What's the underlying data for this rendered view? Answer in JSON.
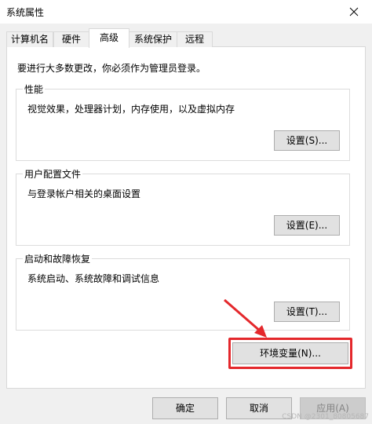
{
  "window": {
    "title": "系统属性"
  },
  "tabs": [
    {
      "label": "计算机名"
    },
    {
      "label": "硬件"
    },
    {
      "label": "高级"
    },
    {
      "label": "系统保护"
    },
    {
      "label": "远程"
    }
  ],
  "admin_notice": "要进行大多数更改，你必须作为管理员登录。",
  "performance": {
    "title": "性能",
    "description": "视觉效果，处理器计划，内存使用，以及虚拟内存",
    "button": "设置(S)..."
  },
  "user_profiles": {
    "title": "用户配置文件",
    "description": "与登录帐户相关的桌面设置",
    "button": "设置(E)..."
  },
  "startup_recovery": {
    "title": "启动和故障恢复",
    "description": "系统启动、系统故障和调试信息",
    "button": "设置(T)..."
  },
  "env_button": "环境变量(N)...",
  "footer": {
    "ok": "确定",
    "cancel": "取消",
    "apply": "应用(A)"
  },
  "watermark": "CSDN @2301_80805687",
  "colors": {
    "highlight": "#e4282c",
    "button_bg": "#e1e1e1",
    "panel_bg": "#ffffff"
  }
}
